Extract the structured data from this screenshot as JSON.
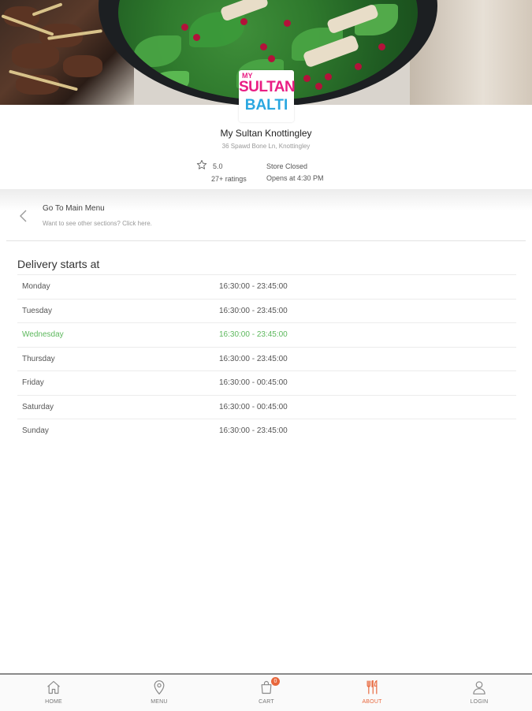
{
  "store": {
    "logo": {
      "line1": "MY",
      "line2": "SULTAN",
      "line3": "BALTI"
    },
    "name": "My Sultan Knottingley",
    "address": "36 Spawd Bone Ln, Knottingley",
    "rating": "5.0",
    "rating_count": "27+ ratings",
    "status": "Store Closed",
    "opens": "Opens at 4:30 PM"
  },
  "back_link": {
    "title": "Go To Main Menu",
    "subtitle": "Want to see other sections? Click here."
  },
  "delivery": {
    "title": "Delivery starts at",
    "days": [
      {
        "day": "Monday",
        "hours": "16:30:00 - 23:45:00",
        "active": false
      },
      {
        "day": "Tuesday",
        "hours": "16:30:00 - 23:45:00",
        "active": false
      },
      {
        "day": "Wednesday",
        "hours": "16:30:00 - 23:45:00",
        "active": true
      },
      {
        "day": "Thursday",
        "hours": "16:30:00 - 23:45:00",
        "active": false
      },
      {
        "day": "Friday",
        "hours": "16:30:00 - 00:45:00",
        "active": false
      },
      {
        "day": "Saturday",
        "hours": "16:30:00 - 00:45:00",
        "active": false
      },
      {
        "day": "Sunday",
        "hours": "16:30:00 - 23:45:00",
        "active": false
      }
    ]
  },
  "tabs": [
    {
      "label": "HOME",
      "icon": "home-icon",
      "active": false
    },
    {
      "label": "MENU",
      "icon": "map-pin-icon",
      "active": false
    },
    {
      "label": "CART",
      "icon": "shopping-bag-icon",
      "active": false,
      "badge": "0"
    },
    {
      "label": "ABOUT",
      "icon": "cutlery-icon",
      "active": true
    },
    {
      "label": "LOGIN",
      "icon": "user-icon",
      "active": false
    }
  ],
  "colors": {
    "active_day": "#5cb85c",
    "accent": "#e8673c",
    "logo_pink": "#e91e84",
    "logo_blue": "#2aa7e0"
  }
}
